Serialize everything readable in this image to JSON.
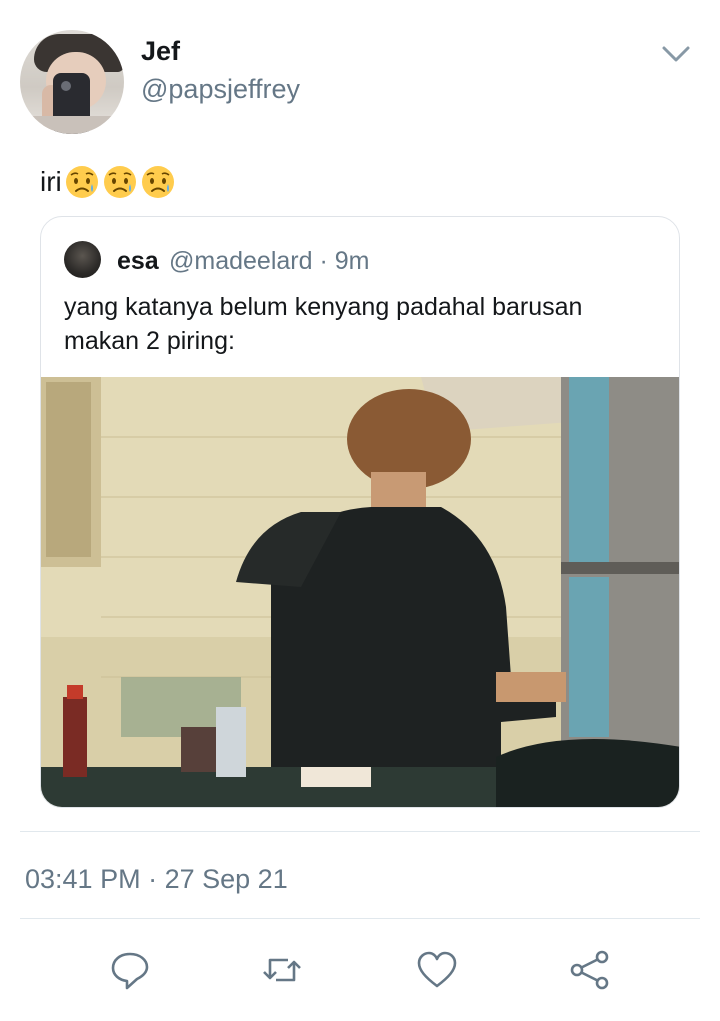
{
  "author": {
    "name": "Jef",
    "handle": "@papsjeffrey",
    "avatar_icon": "profile-photo"
  },
  "menu_icon": "chevron-down-icon",
  "tweet": {
    "text": "iri",
    "emojis": [
      "sad-but-relieved-face",
      "sad-but-relieved-face",
      "sad-but-relieved-face"
    ]
  },
  "quoted_tweet": {
    "name": "esa",
    "handle": "@madeelard",
    "separator": "·",
    "time_ago": "9m",
    "text": "yang katanya belum kenyang padahal barusan makan 2 piring:",
    "media_icon": "kitchen-photo"
  },
  "timestamp": {
    "time": "03:41 PM",
    "separator": "·",
    "date": "27 Sep 21"
  },
  "actions": [
    {
      "icon": "reply-icon"
    },
    {
      "icon": "retweet-icon"
    },
    {
      "icon": "like-icon"
    },
    {
      "icon": "share-icon"
    }
  ],
  "colors": {
    "text_primary": "#14171a",
    "text_secondary": "#657786",
    "border": "#e1e8ed"
  }
}
